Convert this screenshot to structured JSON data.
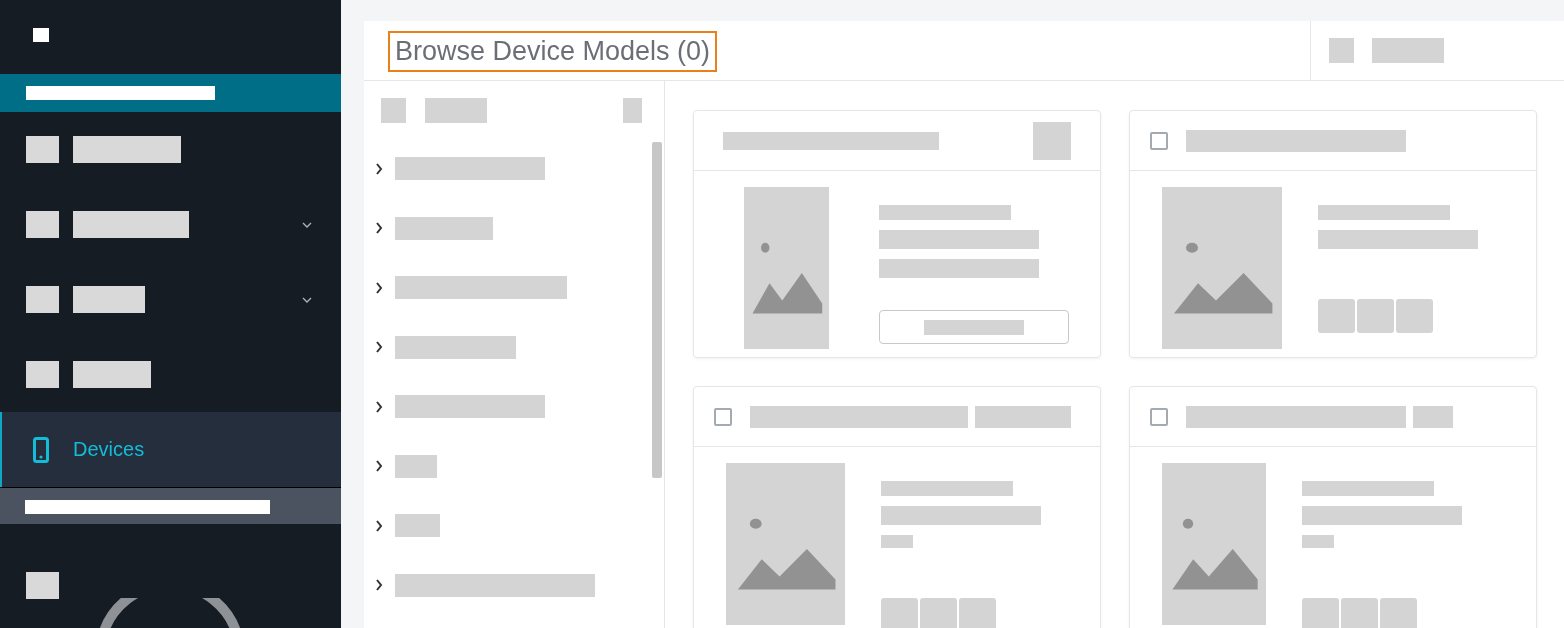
{
  "sidebar": {
    "items": [
      {
        "kind": "placeholder",
        "has_submenu": false,
        "selected": false
      },
      {
        "kind": "placeholder",
        "has_submenu": true,
        "selected": false
      },
      {
        "kind": "placeholder",
        "has_submenu": true,
        "selected": false
      },
      {
        "kind": "placeholder",
        "has_submenu": false,
        "selected": false
      },
      {
        "kind": "link",
        "label": "Devices",
        "selected": true
      }
    ]
  },
  "header": {
    "title": "Browse Device Models (0)",
    "focused": true
  },
  "tree": {
    "items": [
      {
        "expanded": false
      },
      {
        "expanded": false
      },
      {
        "expanded": false
      },
      {
        "expanded": false
      },
      {
        "expanded": false
      },
      {
        "expanded": false
      },
      {
        "expanded": false
      },
      {
        "expanded": false
      }
    ]
  },
  "cards": [
    {
      "kind": "action"
    },
    {
      "kind": "selectable",
      "checked": false
    },
    {
      "kind": "selectable",
      "checked": false
    },
    {
      "kind": "selectable",
      "checked": false
    }
  ]
}
